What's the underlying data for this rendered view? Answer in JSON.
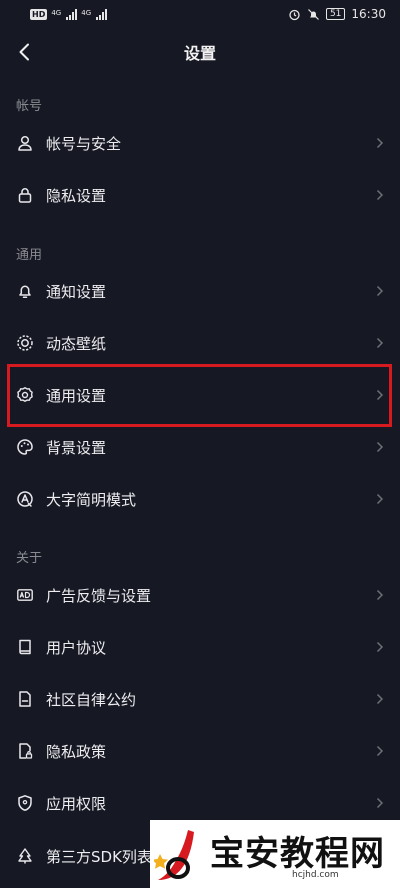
{
  "status_bar": {
    "left_badges": [
      "HD",
      "4G",
      "4G"
    ],
    "battery": "51",
    "time": "16:30"
  },
  "header": {
    "title": "设置",
    "back_icon": "chevron-left-icon"
  },
  "sections": {
    "account": {
      "label": "帐号",
      "items": [
        {
          "label": "帐号与安全",
          "icon": "person-icon"
        },
        {
          "label": "隐私设置",
          "icon": "lock-icon"
        }
      ]
    },
    "general": {
      "label": "通用",
      "items": [
        {
          "label": "通知设置",
          "icon": "bell-icon"
        },
        {
          "label": "动态壁纸",
          "icon": "live-wallpaper-icon"
        },
        {
          "label": "通用设置",
          "icon": "gear-icon",
          "highlighted": true
        },
        {
          "label": "背景设置",
          "icon": "palette-icon"
        },
        {
          "label": "大字简明模式",
          "icon": "large-text-icon"
        }
      ]
    },
    "about": {
      "label": "关于",
      "items": [
        {
          "label": "广告反馈与设置",
          "icon": "ad-icon"
        },
        {
          "label": "用户协议",
          "icon": "book-icon"
        },
        {
          "label": "社区自律公约",
          "icon": "document-icon"
        },
        {
          "label": "隐私政策",
          "icon": "privacy-doc-icon"
        },
        {
          "label": "应用权限",
          "icon": "shield-icon"
        },
        {
          "label": "第三方SDK列表",
          "icon": "tree-icon"
        }
      ]
    }
  },
  "highlight_color": "#d71920",
  "watermark": {
    "text": "宝安教程网",
    "url": "hcjhd.com"
  }
}
